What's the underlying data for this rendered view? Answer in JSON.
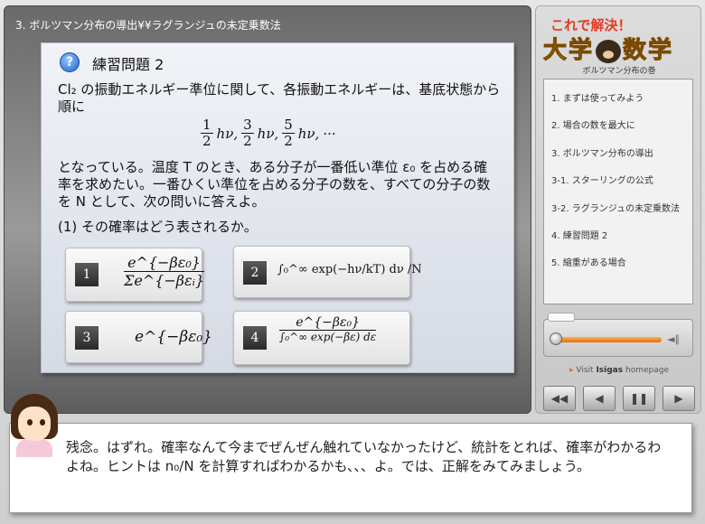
{
  "window": {
    "title": "3. ボルツマン分布の導出¥¥ラグランジュの未定乗数法"
  },
  "exercise": {
    "icon": "question-icon",
    "title": "練習問題 2",
    "paragraph1": "Cl₂ の振動エネルギー準位に関して、各振動エネルギーは、基底状態から順に",
    "sequence": {
      "frac1_num": "1",
      "frac1_den": "2",
      "frac2_num": "3",
      "frac2_den": "2",
      "frac3_num": "5",
      "frac3_den": "2",
      "term": "hν,",
      "dots": "···"
    },
    "paragraph2": "となっている。温度 T のとき、ある分子が一番低い準位 ε₀ を占める確率を求めたい。一番ひくい準位を占める分子の数を、すべての分子の数を N として、次の問いに答えよ。",
    "question": "(1) その確率はどう表されるか。",
    "options": [
      {
        "number": "1",
        "expr_num": "e^{−βε₀}",
        "expr_den": "Σe^{−βεᵢ}"
      },
      {
        "number": "2",
        "expr": "∫₀^∞ exp(−hν/kT) dν /N"
      },
      {
        "number": "3",
        "expr": "e^{−βε₀}"
      },
      {
        "number": "4",
        "expr_num": "e^{−βε₀}",
        "expr_den": "∫₀^∞ exp(−βε) dε"
      }
    ]
  },
  "brand": {
    "tagline": "これで解決！",
    "name_left": "大学",
    "name_right": "数学",
    "subtitle": "ボルツマン分布の巻"
  },
  "menu": {
    "items": [
      "1. まずは使ってみよう",
      "2. 場合の数を最大に",
      "3. ボルツマン分布の導出",
      "3-1. スターリングの公式",
      "3-2. ラグランジュの未定乗数法",
      "4. 練習問題 2",
      "5. 縮重がある場合"
    ]
  },
  "player": {
    "visit_prefix": "Visit",
    "visit_brand": "Isigas",
    "visit_suffix": "homepage",
    "volume_icon": "speaker-icon",
    "progress": 0.05
  },
  "controls": {
    "rewind": "◀◀",
    "back": "◀",
    "pause": "❚❚",
    "play": "▶"
  },
  "dialog": {
    "text": "残念。はずれ。確率なんて今までぜんぜん触れていなかったけど、統計をとれば、確率がわかるわよね。ヒントは n₀/N を計算すればわかるかも、、、よ。では、正解をみてみましょう。"
  },
  "colors": {
    "accent": "#e86a08",
    "brand_yellow": "#ffc21a",
    "brand_red": "#e63a1f"
  }
}
